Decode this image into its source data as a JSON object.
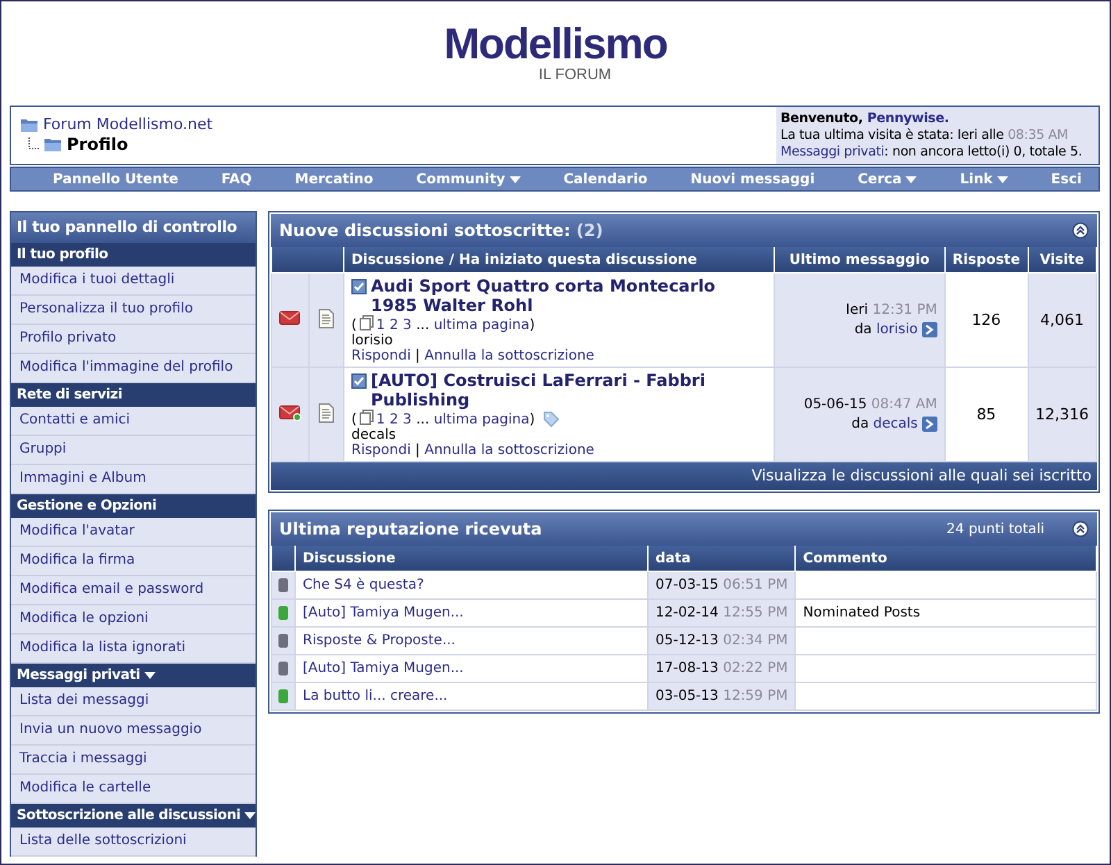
{
  "logo": {
    "title": "Modellismo",
    "subtitle": "IL FORUM"
  },
  "breadcrumb": {
    "parent": "Forum Modellismo.net",
    "current": "Profilo"
  },
  "welcome": {
    "greeting": "Benvenuto,",
    "user": "Pennywise.",
    "last_visit": "La tua ultima visita è stata: Ieri alle",
    "last_visit_time": "08:35 AM",
    "pm_link": "Messaggi privati",
    "pm_status": ": non ancora letto(i) 0, totale 5."
  },
  "navbar": [
    {
      "label": "Pannello Utente",
      "dropdown": false
    },
    {
      "label": "FAQ",
      "dropdown": false
    },
    {
      "label": "Mercatino",
      "dropdown": false
    },
    {
      "label": "Community",
      "dropdown": true
    },
    {
      "label": "Calendario",
      "dropdown": false
    },
    {
      "label": "Nuovi messaggi",
      "dropdown": false
    },
    {
      "label": "Cerca",
      "dropdown": true
    },
    {
      "label": "Link",
      "dropdown": true
    },
    {
      "label": "Esci",
      "dropdown": false
    }
  ],
  "sidebar": {
    "title": "Il tuo pannello di controllo",
    "sections": [
      {
        "title": "Il tuo profilo",
        "dropdown": false,
        "items": [
          "Modifica i tuoi dettagli",
          "Personalizza il tuo profilo",
          "Profilo privato",
          "Modifica l'immagine del profilo"
        ]
      },
      {
        "title": "Rete di servizi",
        "dropdown": false,
        "items": [
          "Contatti e amici",
          "Gruppi",
          "Immagini e Album"
        ]
      },
      {
        "title": "Gestione e Opzioni",
        "dropdown": false,
        "items": [
          "Modifica l'avatar",
          "Modifica la firma",
          "Modifica email e password",
          "Modifica le opzioni",
          "Modifica la lista ignorati"
        ]
      },
      {
        "title": "Messaggi privati",
        "dropdown": true,
        "items": [
          "Lista dei messaggi",
          "Invia un nuovo messaggio",
          "Traccia i messaggi",
          "Modifica le cartelle"
        ]
      },
      {
        "title": "Sottoscrizione alle discussioni",
        "dropdown": true,
        "items": [
          "Lista delle sottoscrizioni"
        ]
      }
    ]
  },
  "subscriptions": {
    "title": "Nuove discussioni sottoscritte:",
    "count": "(2)",
    "columns": [
      "Discussione / Ha iniziato questa discussione",
      "Ultimo messaggio",
      "Risposte",
      "Visite"
    ],
    "threads": [
      {
        "status_dot": false,
        "tagged": false,
        "title": "Audi Sport Quattro corta Montecarlo 1985 Walter Rohl",
        "page_nav": {
          "open": "(",
          "pages": [
            "1",
            "2",
            "3"
          ],
          "ellipsis": "...",
          "last": "ultima pagina",
          "close": ")"
        },
        "starter": "lorisio",
        "actions": [
          "Rispondi",
          "Annulla la sottoscrizione"
        ],
        "separator": "|",
        "last_date": "Ieri",
        "last_time": "12:31 PM",
        "by": "da",
        "last_user": "lorisio",
        "replies": "126",
        "views": "4,061"
      },
      {
        "status_dot": true,
        "tagged": true,
        "title": "[AUTO] Costruisci LaFerrari - Fabbri Publishing",
        "page_nav": {
          "open": "(",
          "pages": [
            "1",
            "2",
            "3"
          ],
          "ellipsis": "...",
          "last": "ultima pagina",
          "close": ")"
        },
        "starter": "decals",
        "actions": [
          "Rispondi",
          "Annulla la sottoscrizione"
        ],
        "separator": "|",
        "last_date": "05-06-15",
        "last_time": "08:47 AM",
        "by": "da",
        "last_user": "decals",
        "replies": "85",
        "views": "12,316"
      }
    ],
    "footer_link": "Visualizza le discussioni alle quali sei iscritto"
  },
  "reputation": {
    "title": "Ultima reputazione ricevuta",
    "total": "24 punti totali",
    "columns": [
      "Discussione",
      "data",
      "Commento"
    ],
    "rows": [
      {
        "color": "#6e6e7e",
        "thread": "Che S4 è questa?",
        "date": "07-03-15",
        "time": "06:51 PM"
      },
      {
        "color": "#3aa83a",
        "thread": "[Auto] Tamiya Mugen...",
        "date": "12-02-14",
        "time": "12:55 PM",
        "comment": "Nominated Posts"
      },
      {
        "color": "#6e6e7e",
        "thread": "Risposte & Proposte...",
        "date": "05-12-13",
        "time": "02:34 PM"
      },
      {
        "color": "#6e6e7e",
        "thread": "[Auto] Tamiya Mugen...",
        "date": "17-08-13",
        "time": "02:22 PM"
      },
      {
        "color": "#3aa83a",
        "thread": "La butto li... creare...",
        "date": "03-05-13",
        "time": "12:59 PM"
      }
    ]
  }
}
